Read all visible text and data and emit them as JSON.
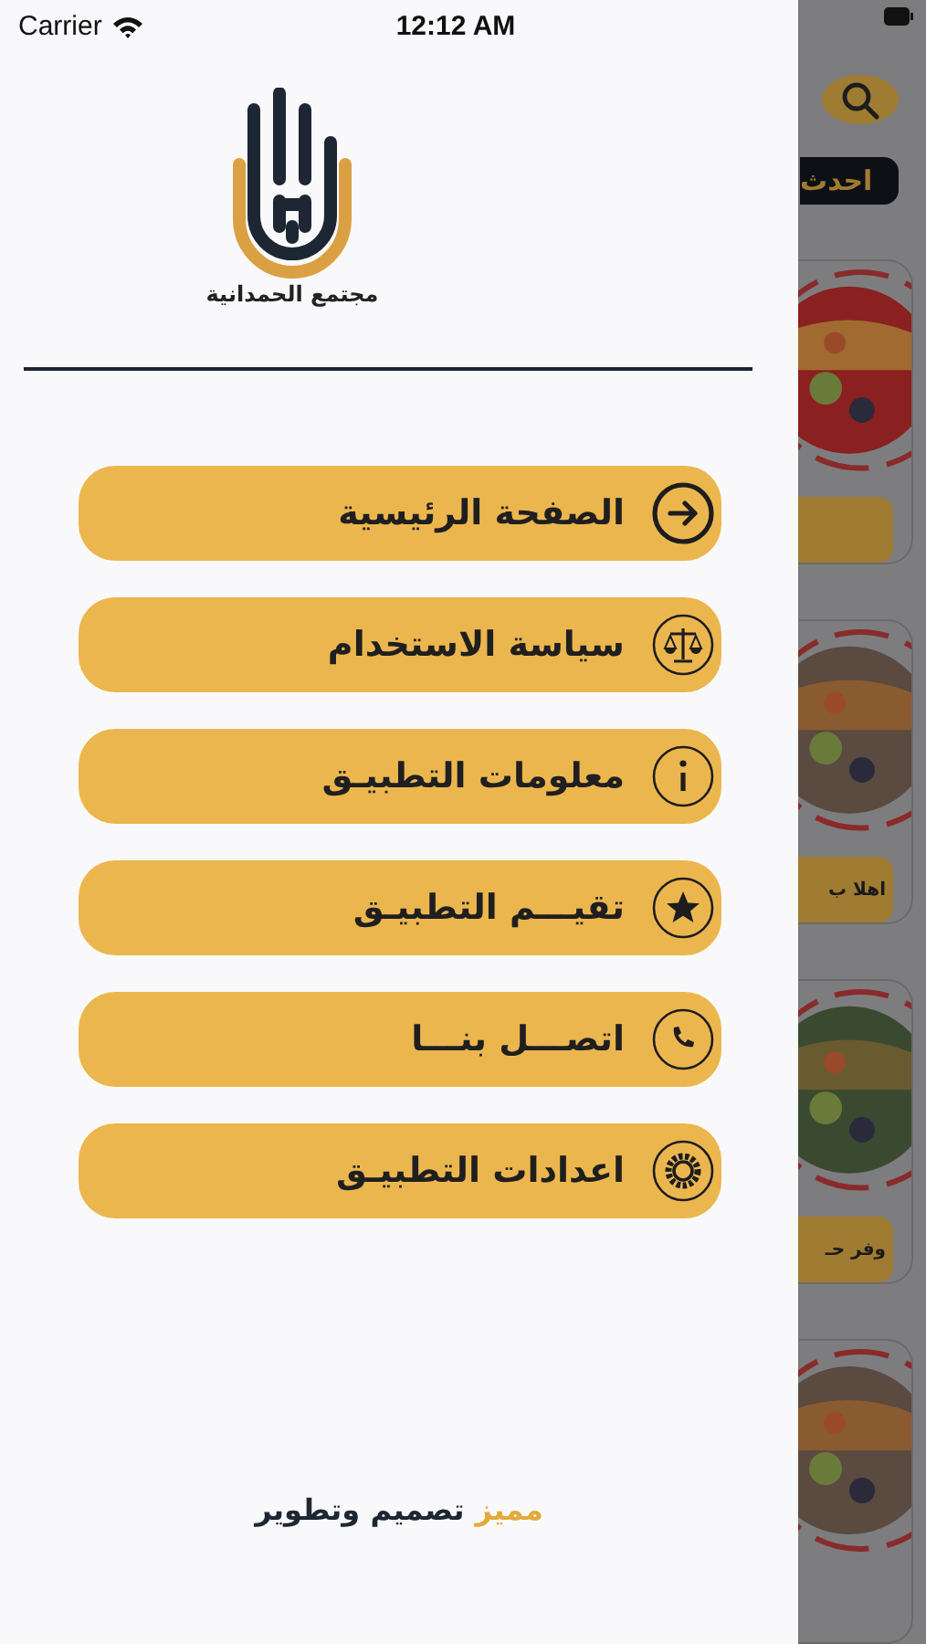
{
  "status_bar": {
    "carrier": "Carrier",
    "time": "12:12 AM"
  },
  "drawer": {
    "logo_text": "مجتمع الحمدانية",
    "menu": [
      {
        "kind": "arrow",
        "label": "الصفحة الرئيسية"
      },
      {
        "kind": "scale",
        "label": "سياسة الاستخدام"
      },
      {
        "kind": "info",
        "label": "معلومات التطبيـق"
      },
      {
        "kind": "star",
        "label": "تقيـــم التطبيـق"
      },
      {
        "kind": "phone",
        "label": "اتصـــل بنـــا"
      },
      {
        "kind": "gear",
        "label": "اعدادات التطبيـق"
      }
    ],
    "footer": {
      "credit": "تصميم وتطوير",
      "brand": "مميز"
    }
  },
  "background": {
    "tab": "احدث",
    "cards": [
      {
        "kind": "button"
      },
      {
        "kind": "button",
        "button_label": "اهلا ب"
      },
      {
        "kind": "button",
        "button_label": "وفر حـ"
      },
      {
        "kind": "plain"
      }
    ]
  }
}
